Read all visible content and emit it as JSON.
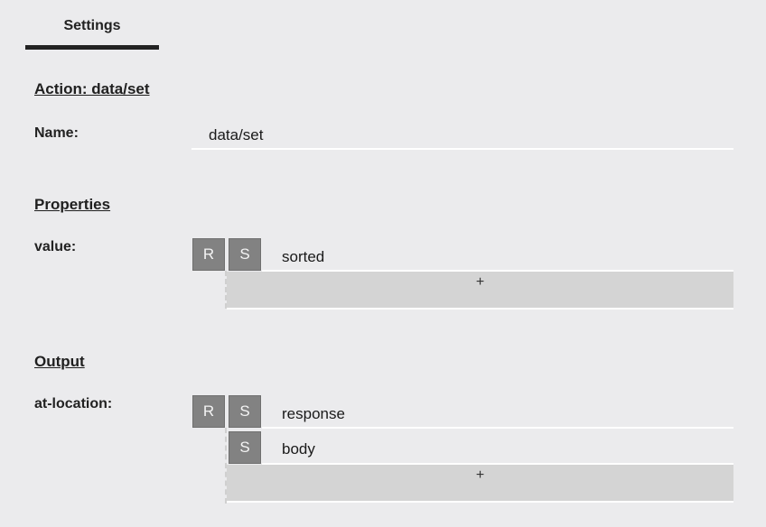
{
  "tabs": {
    "settings_label": "Settings"
  },
  "action": {
    "heading": "Action: data/set",
    "name_label": "Name:",
    "name_value": "data/set"
  },
  "properties": {
    "heading": "Properties",
    "value_label": "value:",
    "value_row": {
      "btn_r": "R",
      "btn_s": "S",
      "text": "sorted"
    },
    "add_label": "+"
  },
  "output": {
    "heading": "Output",
    "at_location_label": "at-location:",
    "rows": [
      {
        "btn_r": "R",
        "btn_s": "S",
        "text": "response"
      },
      {
        "btn_s": "S",
        "text": "body"
      }
    ],
    "add_label": "+"
  }
}
